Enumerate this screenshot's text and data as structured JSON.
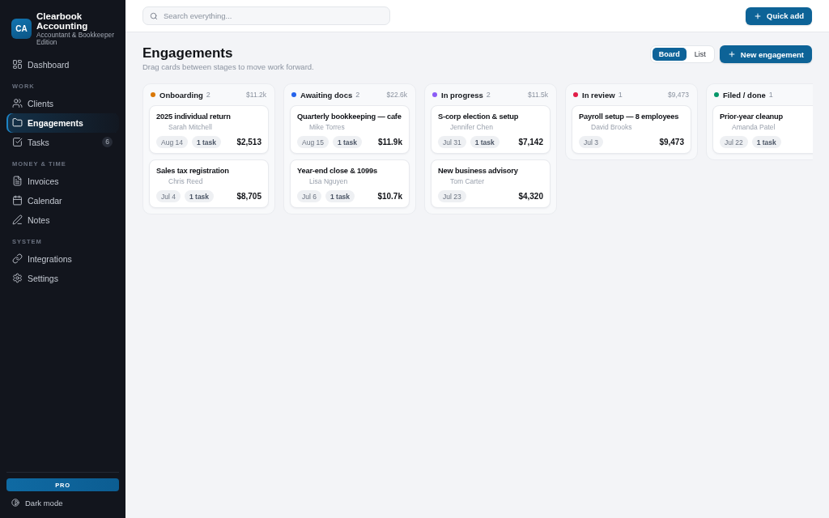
{
  "sidebar": {
    "brand": {
      "initials": "CA",
      "name": "Clearbook Accounting",
      "edition": "Accountant & Bookkeeper Edition"
    },
    "sections": [
      {
        "items": [
          {
            "label": "Dashboard",
            "selected": false
          }
        ]
      },
      {
        "title": "WORK",
        "items": [
          {
            "label": "Clients",
            "selected": false
          },
          {
            "label": "Engagements",
            "selected": true
          },
          {
            "label": "Tasks",
            "selected": false,
            "badge": "6"
          }
        ]
      },
      {
        "title": "MONEY & TIME",
        "items": [
          {
            "label": "Invoices",
            "selected": false
          },
          {
            "label": "Calendar",
            "selected": false
          },
          {
            "label": "Notes",
            "selected": false
          }
        ]
      },
      {
        "title": "SYSTEM",
        "items": [
          {
            "label": "Integrations",
            "selected": false
          },
          {
            "label": "Settings",
            "selected": false
          }
        ]
      }
    ],
    "plan": "PRO",
    "theme_toggle": "Dark mode"
  },
  "top_bar": {
    "search": {
      "placeholder": "Search everything..."
    },
    "quick_add": "Quick add"
  },
  "header": {
    "title": "Engagements",
    "subtitle": "Drag cards between stages to move work forward.",
    "view_tabs": [
      {
        "label": "Board",
        "selected": true
      },
      {
        "label": "List",
        "selected": false
      }
    ],
    "new_button": "New engagement"
  },
  "board": {
    "columns": [
      {
        "name": "Onboarding",
        "count": "2",
        "total": "$11.2k",
        "color": "#d97706",
        "cards": [
          {
            "title": "2025 individual return",
            "client": "Sarah Mitchell",
            "date": "Aug 14",
            "tasks": "1 task",
            "amount": "$2,513"
          },
          {
            "title": "Sales tax registration",
            "client": "Chris Reed",
            "date": "Jul 4",
            "tasks": "1 task",
            "amount": "$8,705"
          }
        ]
      },
      {
        "name": "Awaiting docs",
        "count": "2",
        "total": "$22.6k",
        "color": "#2563eb",
        "cards": [
          {
            "title": "Quarterly bookkeeping — cafe",
            "client": "Mike Torres",
            "date": "Aug 15",
            "tasks": "1 task",
            "amount": "$11.9k"
          },
          {
            "title": "Year-end close & 1099s",
            "client": "Lisa Nguyen",
            "date": "Jul 6",
            "tasks": "1 task",
            "amount": "$10.7k"
          }
        ]
      },
      {
        "name": "In progress",
        "count": "2",
        "total": "$11.5k",
        "color": "#8b5cf6",
        "cards": [
          {
            "title": "S-corp election & setup",
            "client": "Jennifer Chen",
            "date": "Jul 31",
            "tasks": "1 task",
            "amount": "$7,142"
          },
          {
            "title": "New business advisory",
            "client": "Tom Carter",
            "date": "Jul 23",
            "amount": "$4,320"
          }
        ]
      },
      {
        "name": "In review",
        "count": "1",
        "total": "$9,473",
        "color": "#e11d48",
        "cards": [
          {
            "title": "Payroll setup — 8 employees",
            "client": "David Brooks",
            "date": "Jul 3",
            "amount": "$9,473"
          }
        ]
      },
      {
        "name": "Filed / done",
        "count": "1",
        "color": "#059669",
        "cards": [
          {
            "title": "Prior-year cleanup",
            "client": "Amanda Patel",
            "date": "Jul 22",
            "tasks": "1 task"
          }
        ]
      }
    ]
  }
}
